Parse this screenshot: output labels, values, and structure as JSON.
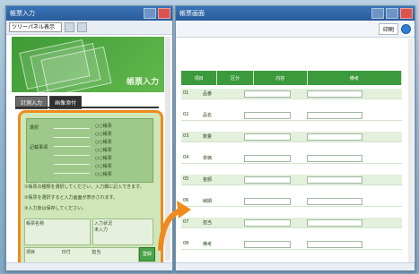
{
  "left_window": {
    "title": "帳票入力",
    "selector_value": "ツリーパネル表示",
    "banner_logo": "帳票入力",
    "tabs": [
      {
        "label": "計測入力",
        "active": false
      },
      {
        "label": "画像添付",
        "active": true
      }
    ],
    "panel": {
      "row_labels": [
        "選択",
        "記載事項"
      ],
      "checkbox_labels": [
        "○○帳票",
        "○○帳票",
        "○○帳票",
        "○○帳票",
        "○○帳票",
        "○○帳票",
        "○○帳票"
      ],
      "notes": [
        "①帳票の種類を選択してください。入力欄に記入できます。",
        "②帳票を選択すると入力画面が表示されます。",
        "③入力後は保存してください。"
      ],
      "box_left_label": "帳票名称",
      "box_right_label": "入力状況",
      "box_right_value": "未入力",
      "bottom_fields": [
        {
          "label": "項目",
          "value": ""
        },
        {
          "label": "日付",
          "value": ""
        },
        {
          "label": "担当",
          "value": ""
        }
      ],
      "button_label": "登録"
    }
  },
  "right_window": {
    "title": "帳票画面",
    "toolbar_buttons": [
      "印刷"
    ],
    "form": {
      "header_cells": [
        "項目",
        "区分",
        "内容",
        "備考"
      ],
      "rows": [
        {
          "no": "01",
          "label": "品番",
          "value": "",
          "note": ""
        },
        {
          "no": "02",
          "label": "品名",
          "value": "",
          "note": ""
        },
        {
          "no": "03",
          "label": "数量",
          "value": "",
          "note": ""
        },
        {
          "no": "04",
          "label": "単価",
          "value": "",
          "note": ""
        },
        {
          "no": "05",
          "label": "金額",
          "value": "",
          "note": ""
        },
        {
          "no": "06",
          "label": "納期",
          "value": "",
          "note": ""
        },
        {
          "no": "07",
          "label": "担当",
          "value": "",
          "note": ""
        },
        {
          "no": "08",
          "label": "備考",
          "value": "",
          "note": ""
        }
      ]
    }
  },
  "colors": {
    "accent_orange": "#f08a1c",
    "header_green": "#3b9a3b",
    "banner_green": "#4fae40"
  }
}
